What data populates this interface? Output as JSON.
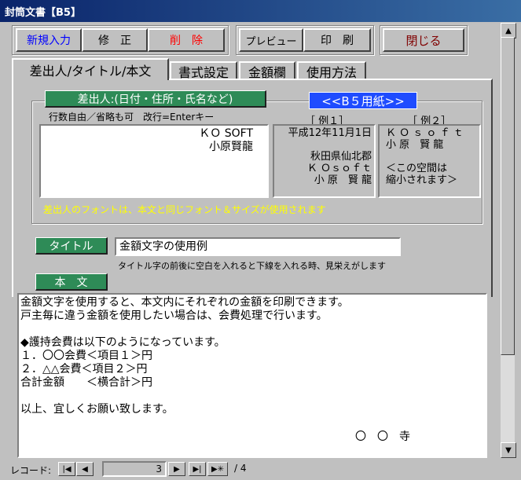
{
  "window": {
    "title": "封筒文書【B5】"
  },
  "toolbar": {
    "new_label": "新規入力",
    "edit_label": "修　正",
    "delete_label": "削　除",
    "preview_label": "プレビュー",
    "print_label": "印　刷",
    "close_label": "閉じる",
    "colors": {
      "new": "#0000ff",
      "delete": "#ff0000",
      "close": "#800000"
    }
  },
  "tabs": [
    {
      "label": "差出人/タイトル/本文",
      "active": true
    },
    {
      "label": "書式設定"
    },
    {
      "label": "金額欄"
    },
    {
      "label": "使用方法"
    }
  ],
  "sender": {
    "group_label": "差出人:(日付・住所・氏名など)",
    "paper_badge": "<<B５用紙>>",
    "hint": "行数自由／省略も可　改行=Enterキー",
    "text": "ＫＯ SOFT\n小原賢龍",
    "example1_title": "［ 例１］",
    "example1_body": "平成12年11月1日\n\n秋田県仙北郡\nＫ Ｏｓｏｆｔ\n小 原　賢 龍",
    "example2_title": "［ 例２］",
    "example2_body": "Ｋ Ｏ ｓ ｏ ｆ ｔ\n小 原　賢 龍\n\n＜この空間は\n縮小されます＞",
    "font_note": "差出人のフォントは、本文と同じフォント＆サイズが使用されます"
  },
  "title_field": {
    "label": "タイトル",
    "value": "金額文字の使用例",
    "hint": "タイトル字の前後に空白を入れると下線を入れる時、見栄えがします"
  },
  "body_field": {
    "label": "本　文",
    "text": "金額文字を使用すると、本文内にそれぞれの金額を印刷できます。\n戸主毎に違う金額を使用したい場合は、会費処理で行います。\n\n◆護持会費は以下のようになっています。\n１．〇〇会費＜項目１＞円\n２．△△会費＜項目２＞円\n合計金額　　＜横合計＞円\n\n以上、宜しくお願い致します。",
    "signature": "〇　〇　寺"
  },
  "record_nav": {
    "label": "レコード:",
    "current": "3",
    "total": "/ 4"
  },
  "icons": [
    "first-record-icon",
    "prev-record-icon",
    "next-record-icon",
    "last-record-icon",
    "new-record-icon",
    "scroll-up-icon",
    "scroll-down-icon"
  ]
}
